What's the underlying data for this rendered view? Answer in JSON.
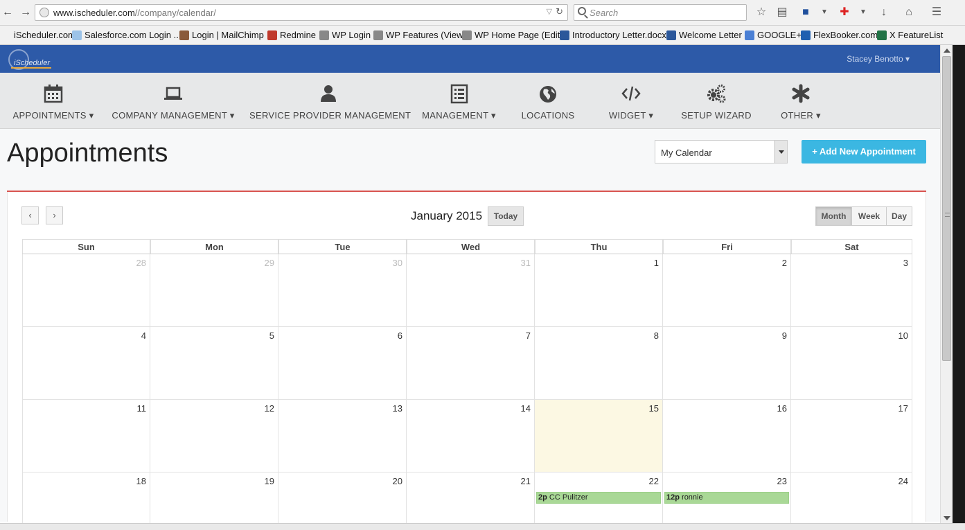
{
  "browser": {
    "url_host": "www.ischeduler.com",
    "url_path": "//company/calendar/",
    "search_placeholder": "Search"
  },
  "bookmarks": [
    {
      "label": "iScheduler.com",
      "icon": "blank-page-icon",
      "color": "#f1f1f1"
    },
    {
      "label": "Salesforce.com Login ...",
      "icon": "cloud-icon",
      "color": "#9cc3e8"
    },
    {
      "label": "Login | MailChimp",
      "icon": "chimp-icon",
      "color": "#8a5a3a"
    },
    {
      "label": "Redmine",
      "icon": "redmine-icon",
      "color": "#c0392b"
    },
    {
      "label": "WP Login",
      "icon": "gauge-icon",
      "color": "#888888"
    },
    {
      "label": "WP Features (View)",
      "icon": "gauge-icon",
      "color": "#888888"
    },
    {
      "label": "WP Home Page (Edit)",
      "icon": "gauge-icon",
      "color": "#888888"
    },
    {
      "label": "Introductory Letter.docx",
      "icon": "word-icon",
      "color": "#2b579a"
    },
    {
      "label": "Welcome Letter",
      "icon": "word-icon",
      "color": "#2b579a"
    },
    {
      "label": "GOOGLE+",
      "icon": "google-icon",
      "color": "#4a7fd4"
    },
    {
      "label": "FlexBooker.com",
      "icon": "fb-icon",
      "color": "#1f5fb0"
    },
    {
      "label": "X FeatureList",
      "icon": "excel-icon",
      "color": "#217346"
    }
  ],
  "header": {
    "logo_text": "iScheduler",
    "user_name": "Stacey Benotto ▾"
  },
  "nav": [
    {
      "label": "APPOINTMENTS ▾",
      "icon": "calendar-icon"
    },
    {
      "label": "COMPANY MANAGEMENT ▾",
      "icon": "laptop-icon"
    },
    {
      "label": "SERVICE PROVIDER MANAGEMENT",
      "icon": "user-icon"
    },
    {
      "label": "MANAGEMENT ▾",
      "icon": "list-icon"
    },
    {
      "label": "LOCATIONS",
      "icon": "globe-icon"
    },
    {
      "label": "WIDGET ▾",
      "icon": "code-icon"
    },
    {
      "label": "SETUP WIZARD",
      "icon": "gears-icon"
    },
    {
      "label": "OTHER ▾",
      "icon": "asterisk-icon"
    }
  ],
  "page": {
    "title": "Appointments",
    "calendar_select": "My Calendar",
    "add_button": "+ Add New Appointment"
  },
  "calendar": {
    "month_title": "January 2015",
    "today_label": "Today",
    "prev_label": "‹",
    "next_label": "›",
    "views": [
      "Month",
      "Week",
      "Day"
    ],
    "active_view": "Month",
    "weekdays": [
      "Sun",
      "Mon",
      "Tue",
      "Wed",
      "Thu",
      "Fri",
      "Sat"
    ],
    "weeks": [
      [
        {
          "d": "28",
          "other": true
        },
        {
          "d": "29",
          "other": true
        },
        {
          "d": "30",
          "other": true
        },
        {
          "d": "31",
          "other": true
        },
        {
          "d": "1"
        },
        {
          "d": "2"
        },
        {
          "d": "3"
        }
      ],
      [
        {
          "d": "4"
        },
        {
          "d": "5"
        },
        {
          "d": "6"
        },
        {
          "d": "7"
        },
        {
          "d": "8"
        },
        {
          "d": "9"
        },
        {
          "d": "10"
        }
      ],
      [
        {
          "d": "11"
        },
        {
          "d": "12"
        },
        {
          "d": "13"
        },
        {
          "d": "14"
        },
        {
          "d": "15",
          "today": true
        },
        {
          "d": "16"
        },
        {
          "d": "17"
        }
      ],
      [
        {
          "d": "18"
        },
        {
          "d": "19"
        },
        {
          "d": "20"
        },
        {
          "d": "21"
        },
        {
          "d": "22",
          "event": {
            "time": "2p",
            "title": "CC Pulitzer"
          }
        },
        {
          "d": "23",
          "event": {
            "time": "12p",
            "title": "ronnie"
          }
        },
        {
          "d": "24"
        }
      ]
    ]
  }
}
